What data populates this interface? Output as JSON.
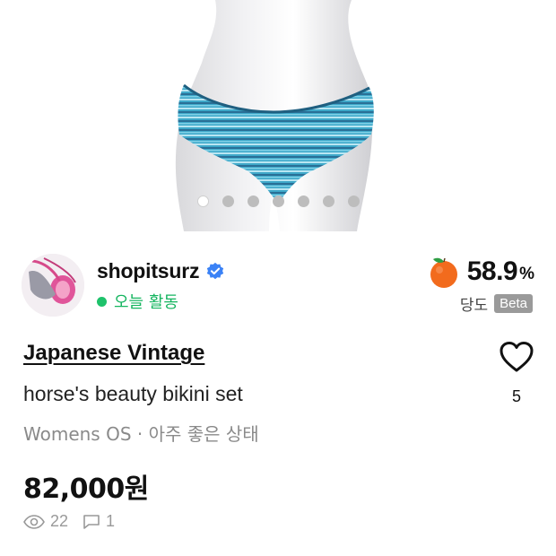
{
  "listing": {
    "image_indicator": {
      "count": 7,
      "active_index": 0
    },
    "seller": {
      "name": "shopitsurz",
      "activity": "오늘 활동",
      "verified_icon": "verified-check-icon"
    },
    "sweetness": {
      "value": "58.9",
      "unit": "%",
      "label": "당도",
      "badge": "Beta",
      "icon": "orange-fruit-icon"
    },
    "brand": "Japanese Vintage",
    "title": "horse's beauty bikini set",
    "meta": "Womens OS · 아주 좋은 상태",
    "price": "82,000원",
    "likes": {
      "count": "5",
      "icon": "heart-icon"
    },
    "stats": {
      "views": "22",
      "comments": "1"
    }
  },
  "colors": {
    "accent_green": "#1ec26b",
    "verified_blue": "#3b82f6",
    "orange": "#f26b1d",
    "muted_text": "#8a8a8a"
  }
}
